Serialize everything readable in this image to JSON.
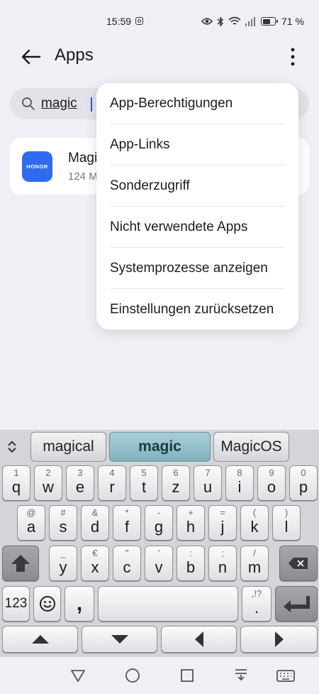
{
  "status_bar": {
    "time": "15:59",
    "battery_percent": "71 %",
    "battery_level": 0.71
  },
  "header": {
    "title": "Apps"
  },
  "search": {
    "value": "magic"
  },
  "app_list": [
    {
      "name": "Magic",
      "size": "124 M",
      "icon_label": "HONOR",
      "icon_color": "#2f6bef"
    }
  ],
  "menu": {
    "items": [
      "App-Berechtigungen",
      "App-Links",
      "Sonderzugriff",
      "Nicht verwendete Apps",
      "Systemprozesse anzeigen",
      "Einstellungen zurücksetzen"
    ]
  },
  "keyboard": {
    "suggestions": [
      "magical",
      "magic",
      "MagicOS"
    ],
    "active_suggestion": "magic",
    "row1": [
      {
        "main": "q",
        "hint": "1"
      },
      {
        "main": "w",
        "hint": "2"
      },
      {
        "main": "e",
        "hint": "3"
      },
      {
        "main": "r",
        "hint": "4"
      },
      {
        "main": "t",
        "hint": "5"
      },
      {
        "main": "z",
        "hint": "6"
      },
      {
        "main": "u",
        "hint": "7"
      },
      {
        "main": "i",
        "hint": "8"
      },
      {
        "main": "o",
        "hint": "9"
      },
      {
        "main": "p",
        "hint": "0"
      }
    ],
    "row2": [
      {
        "main": "a",
        "hint": "@"
      },
      {
        "main": "s",
        "hint": "#"
      },
      {
        "main": "d",
        "hint": "&"
      },
      {
        "main": "f",
        "hint": "*"
      },
      {
        "main": "g",
        "hint": "-"
      },
      {
        "main": "h",
        "hint": "+"
      },
      {
        "main": "j",
        "hint": "="
      },
      {
        "main": "k",
        "hint": "("
      },
      {
        "main": "l",
        "hint": ")"
      }
    ],
    "row3": [
      {
        "main": "y",
        "hint": "_"
      },
      {
        "main": "x",
        "hint": "€"
      },
      {
        "main": "c",
        "hint": "\""
      },
      {
        "main": "v",
        "hint": "'"
      },
      {
        "main": "b",
        "hint": ":"
      },
      {
        "main": "n",
        "hint": ";"
      },
      {
        "main": "m",
        "hint": "/"
      }
    ],
    "numbers_label": "123",
    "comma": ",",
    "period": ".",
    "period_hint": ",!?"
  },
  "colors": {
    "background": "#eff0f5",
    "accent": "#2f6bef",
    "suggestion_active": "#7fb2bf"
  }
}
